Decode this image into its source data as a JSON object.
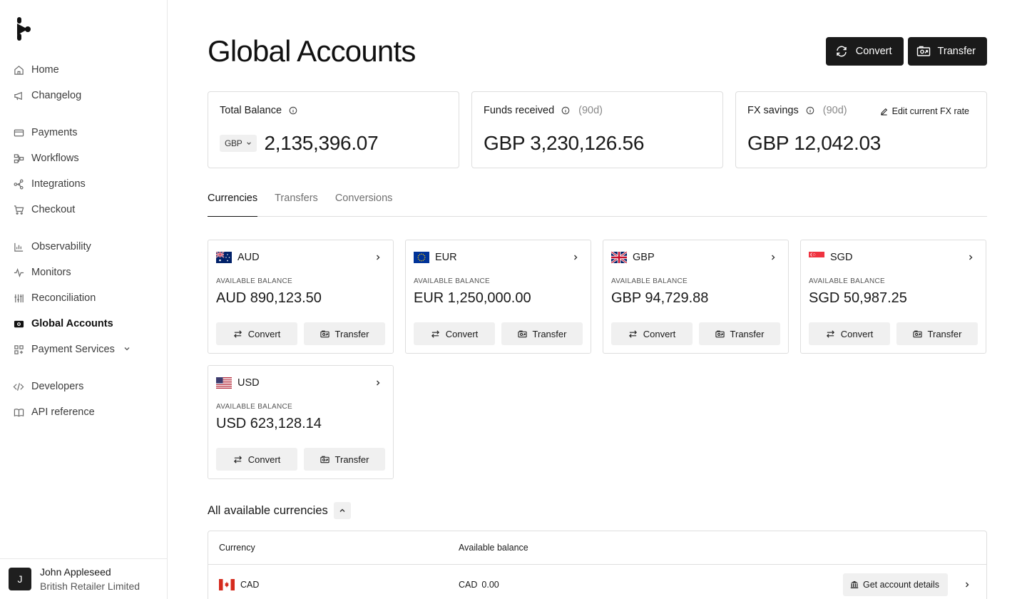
{
  "sidebar": {
    "groups": [
      [
        {
          "label": "Home",
          "icon": "home-icon"
        },
        {
          "label": "Changelog",
          "icon": "megaphone-icon"
        }
      ],
      [
        {
          "label": "Payments",
          "icon": "credit-card-icon"
        },
        {
          "label": "Workflows",
          "icon": "workflow-icon"
        },
        {
          "label": "Integrations",
          "icon": "integrations-icon"
        },
        {
          "label": "Checkout",
          "icon": "cart-icon"
        }
      ],
      [
        {
          "label": "Observability",
          "icon": "chart-icon"
        },
        {
          "label": "Monitors",
          "icon": "pulse-icon"
        },
        {
          "label": "Reconciliation",
          "icon": "sliders-icon"
        },
        {
          "label": "Global Accounts",
          "icon": "camera-icon",
          "active": true
        },
        {
          "label": "Payment Services",
          "icon": "grid-icon",
          "expandable": true
        }
      ],
      [
        {
          "label": "Developers",
          "icon": "code-icon"
        },
        {
          "label": "API reference",
          "icon": "book-icon"
        }
      ]
    ],
    "user": {
      "initial": "J",
      "name": "John Appleseed",
      "org": "British Retailer Limited"
    }
  },
  "header": {
    "title": "Global Accounts",
    "convert_label": "Convert",
    "transfer_label": "Transfer"
  },
  "stats": {
    "total_balance": {
      "label": "Total Balance",
      "currency": "GBP",
      "value": "2,135,396.07"
    },
    "funds_received": {
      "label": "Funds received",
      "period": "(90d)",
      "value": "GBP 3,230,126.56"
    },
    "fx_savings": {
      "label": "FX savings",
      "period": "(90d)",
      "value": "GBP 12,042.03",
      "edit_label": "Edit current FX rate"
    }
  },
  "tabs": [
    "Currencies",
    "Transfers",
    "Conversions"
  ],
  "cards": {
    "available_label": "AVAILABLE BALANCE",
    "convert_label": "Convert",
    "transfer_label": "Transfer",
    "items": [
      {
        "code": "AUD",
        "balance": "AUD 890,123.50"
      },
      {
        "code": "EUR",
        "balance": "EUR 1,250,000.00"
      },
      {
        "code": "GBP",
        "balance": "GBP 94,729.88"
      },
      {
        "code": "SGD",
        "balance": "SGD 50,987.25"
      },
      {
        "code": "USD",
        "balance": "USD 623,128.14"
      }
    ]
  },
  "all_currencies": {
    "title": "All available currencies",
    "columns": [
      "Currency",
      "Available balance"
    ],
    "rows": [
      {
        "code": "CAD",
        "balance_cur": "CAD",
        "balance": "0.00",
        "action": "Get account details"
      }
    ]
  }
}
